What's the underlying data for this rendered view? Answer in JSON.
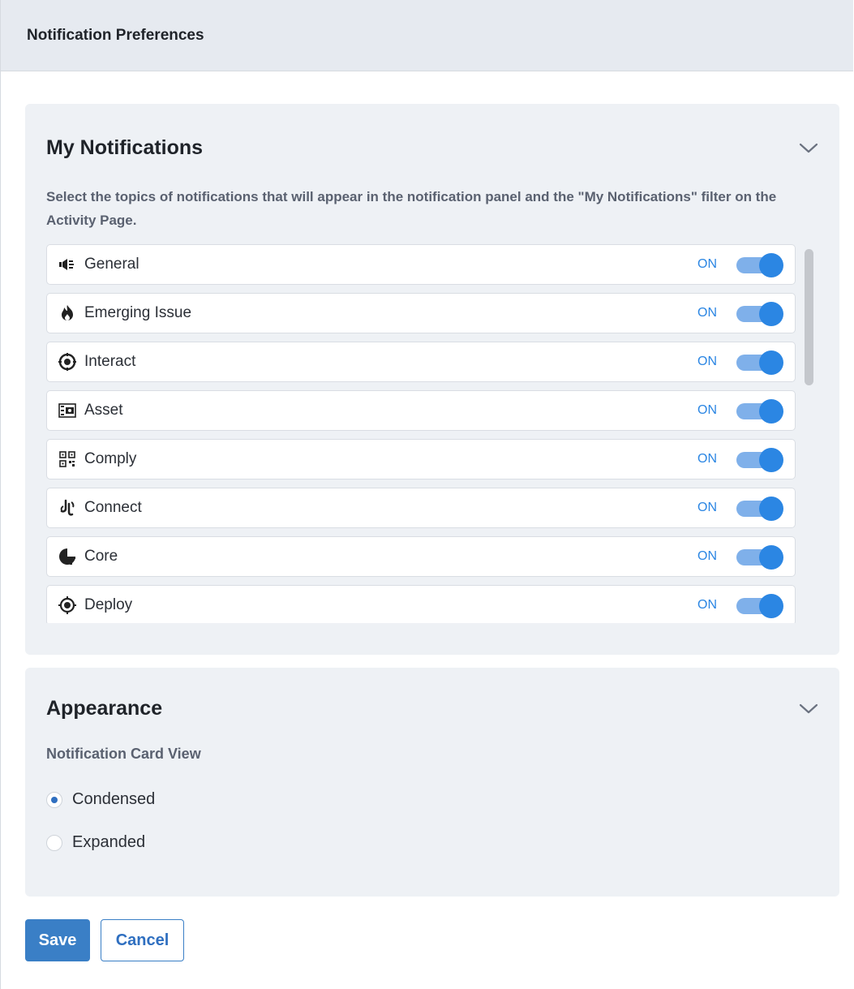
{
  "header": {
    "title": "Notification Preferences"
  },
  "my_notifications": {
    "title": "My Notifications",
    "description": "Select the topics of notifications that will appear in the notification panel and the \"My Notifications\" filter on the Activity Page.",
    "topics": [
      {
        "label": "General",
        "status": "ON",
        "icon": "megaphone-icon",
        "enabled": true
      },
      {
        "label": "Emerging Issue",
        "status": "ON",
        "icon": "flame-icon",
        "enabled": true
      },
      {
        "label": "Interact",
        "status": "ON",
        "icon": "interact-target-icon",
        "enabled": true
      },
      {
        "label": "Asset",
        "status": "ON",
        "icon": "asset-grid-icon",
        "enabled": true
      },
      {
        "label": "Comply",
        "status": "ON",
        "icon": "qr-code-icon",
        "enabled": true
      },
      {
        "label": "Connect",
        "status": "ON",
        "icon": "connect-plug-icon",
        "enabled": true
      },
      {
        "label": "Core",
        "status": "ON",
        "icon": "core-shield-icon",
        "enabled": true
      },
      {
        "label": "Deploy",
        "status": "ON",
        "icon": "deploy-target-icon",
        "enabled": true
      }
    ]
  },
  "appearance": {
    "title": "Appearance",
    "card_view_label": "Notification Card View",
    "options": [
      {
        "label": "Condensed",
        "selected": true
      },
      {
        "label": "Expanded",
        "selected": false
      }
    ]
  },
  "actions": {
    "save_label": "Save",
    "cancel_label": "Cancel"
  },
  "colors": {
    "accent": "#2b86e3",
    "button": "#3a7fc6",
    "toggle_track": "#7fb0ea",
    "panel_bg": "#eef1f5",
    "header_bg": "#e6eaf0"
  }
}
